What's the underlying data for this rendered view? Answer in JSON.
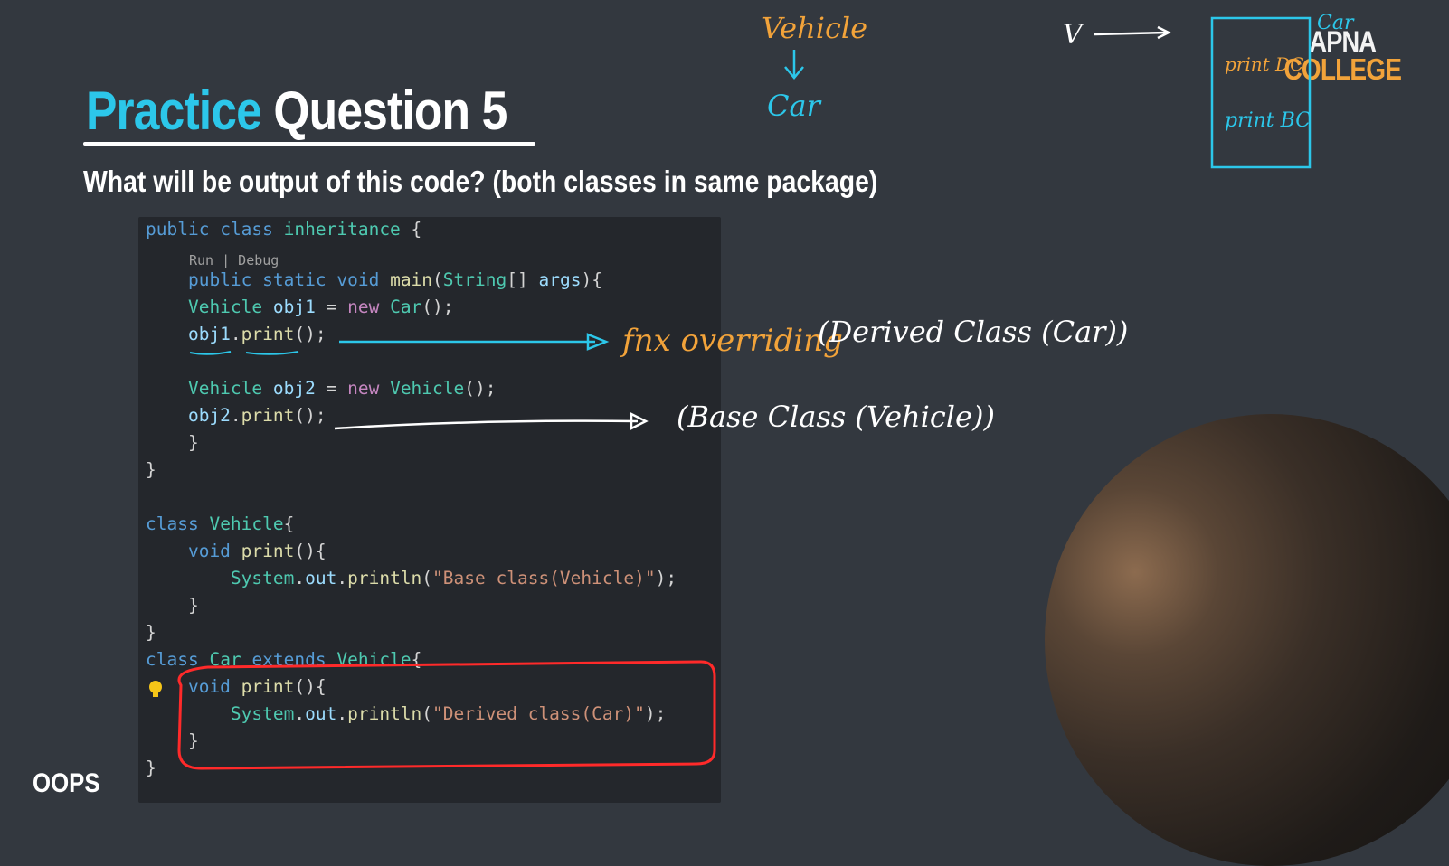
{
  "slide": {
    "title_accent": "Practice",
    "title_rest": "Question 5",
    "subtitle": "What will be output of this code? (both classes in same package)",
    "footer_label": "OOPS"
  },
  "logo": {
    "line1": "APNA",
    "line2": "COLLEGE"
  },
  "editor": {
    "codelens": "Run | Debug",
    "lines": {
      "l1": {
        "t1": "public",
        "t2": " ",
        "t3": "class",
        "t4": " ",
        "t5": "inheritance",
        "t6": " {"
      },
      "l3": {
        "t1": "    public",
        "t2": " ",
        "t3": "static",
        "t4": " ",
        "t5": "void",
        "t6": " ",
        "t7": "main",
        "t8": "(",
        "t9": "String",
        "t10": "[] ",
        "t11": "args",
        "t12": "){"
      },
      "l4": {
        "t1": "    Vehicle",
        "t2": " ",
        "t3": "obj1",
        "t4": " = ",
        "t5": "new",
        "t6": " ",
        "t7": "Car",
        "t8": "();"
      },
      "l5": {
        "t1": "    obj1",
        "t2": ".",
        "t3": "print",
        "t4": "();"
      },
      "l6": {
        "t1": "    Vehicle",
        "t2": " ",
        "t3": "obj2",
        "t4": " = ",
        "t5": "new",
        "t6": " ",
        "t7": "Vehicle",
        "t8": "();"
      },
      "l7": {
        "t1": "    obj2",
        "t2": ".",
        "t3": "print",
        "t4": "();"
      },
      "l8": {
        "t1": "    }"
      },
      "l9": {
        "t1": "}"
      },
      "l10": {
        "t1": "class",
        "t2": " ",
        "t3": "Vehicle",
        "t4": "{"
      },
      "l11": {
        "t1": "    void",
        "t2": " ",
        "t3": "print",
        "t4": "(){"
      },
      "l12": {
        "t1": "        System",
        "t2": ".",
        "t3": "out",
        "t4": ".",
        "t5": "println",
        "t6": "(",
        "t7": "\"Base class(Vehicle)\"",
        "t8": ");"
      },
      "l13": {
        "t1": "    }"
      },
      "l14": {
        "t1": "}"
      },
      "l15": {
        "t1": "class",
        "t2": " ",
        "t3": "Car",
        "t4": " ",
        "t5": "extends",
        "t6": " ",
        "t7": "Vehicle",
        "t8": "{"
      },
      "l16": {
        "t1": "    void",
        "t2": " ",
        "t3": "print",
        "t4": "(){"
      },
      "l17": {
        "t1": "        System",
        "t2": ".",
        "t3": "out",
        "t4": ".",
        "t5": "println",
        "t6": "(",
        "t7": "\"Derived class(Car)\"",
        "t8": ");"
      },
      "l18": {
        "t1": "    }"
      },
      "l19": {
        "t1": "}"
      }
    }
  },
  "annotations": {
    "vehicle": "Vehicle",
    "car": "Car",
    "v_label": "V",
    "box_top": "Car",
    "box_item1": "print DC",
    "box_item2": "print BC",
    "arrow1_text": "fnx overriding",
    "arrow1_paren": "(Derived Class (Car))",
    "arrow2_paren": "(Base Class (Vehicle))"
  },
  "colors": {
    "accent": "#2cc7ea",
    "annotation_orange": "#f2a33a",
    "annotation_blue": "#2cc7ea",
    "highlight_red": "#ff2a2a"
  }
}
